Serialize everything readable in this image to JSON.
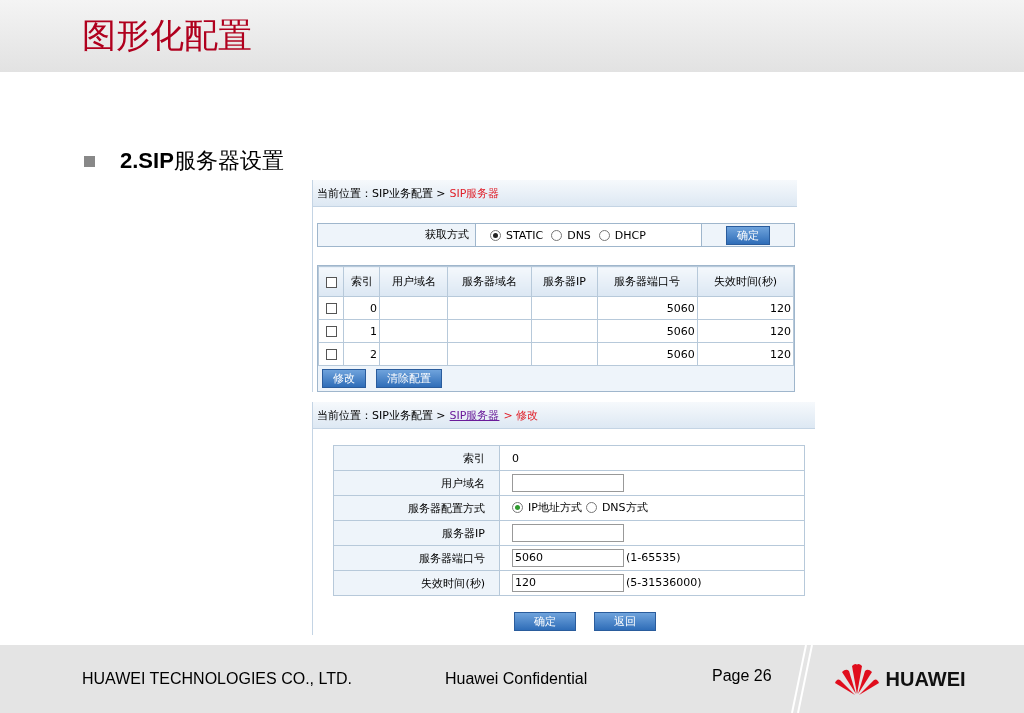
{
  "title": "图形化配置",
  "bullet": {
    "number": "2.SIP",
    "text": "服务器设置"
  },
  "list_panel": {
    "breadcrumb": [
      "当前位置：SIP业务配置 >",
      "SIP服务器"
    ],
    "mode": {
      "label": "获取方式",
      "options": [
        {
          "label": "STATIC",
          "selected": true
        },
        {
          "label": "DNS",
          "selected": false
        },
        {
          "label": "DHCP",
          "selected": false
        }
      ],
      "button": "确定"
    },
    "table": {
      "header_checked": false,
      "columns": [
        "索引",
        "用户域名",
        "服务器域名",
        "服务器IP",
        "服务器端口号",
        "失效时间(秒)"
      ],
      "rows": [
        {
          "checked": false,
          "cells": [
            "0",
            "",
            "",
            "",
            "5060",
            "120"
          ]
        },
        {
          "checked": false,
          "cells": [
            "1",
            "",
            "",
            "",
            "5060",
            "120"
          ]
        },
        {
          "checked": false,
          "cells": [
            "2",
            "",
            "",
            "",
            "5060",
            "120"
          ]
        }
      ]
    },
    "buttons": [
      "修改",
      "清除配置"
    ]
  },
  "edit_panel": {
    "breadcrumb": [
      "当前位置：SIP业务配置 >",
      "SIP服务器",
      "> 修改"
    ],
    "fields": [
      {
        "kind": "text",
        "label": "索引",
        "value": "0"
      },
      {
        "kind": "input",
        "label": "用户域名"
      },
      {
        "kind": "radio",
        "label": "服务器配置方式",
        "options": [
          {
            "label": "IP地址方式",
            "selected": true
          },
          {
            "label": "DNS方式",
            "selected": false
          }
        ]
      },
      {
        "kind": "input",
        "label": "服务器IP"
      },
      {
        "kind": "input",
        "label": "服务器端口号",
        "value": "5060",
        "hint": "(1-65535)"
      },
      {
        "kind": "input",
        "label": "失效时间(秒)",
        "value": "120",
        "hint": "(5-31536000)"
      }
    ],
    "buttons": [
      "确定",
      "返回"
    ]
  },
  "footer": {
    "company": "HUAWEI TECHNOLOGIES CO., LTD.",
    "confidential": "Huawei Confidential",
    "page": "Page 26",
    "logo_text": "HUAWEI"
  }
}
